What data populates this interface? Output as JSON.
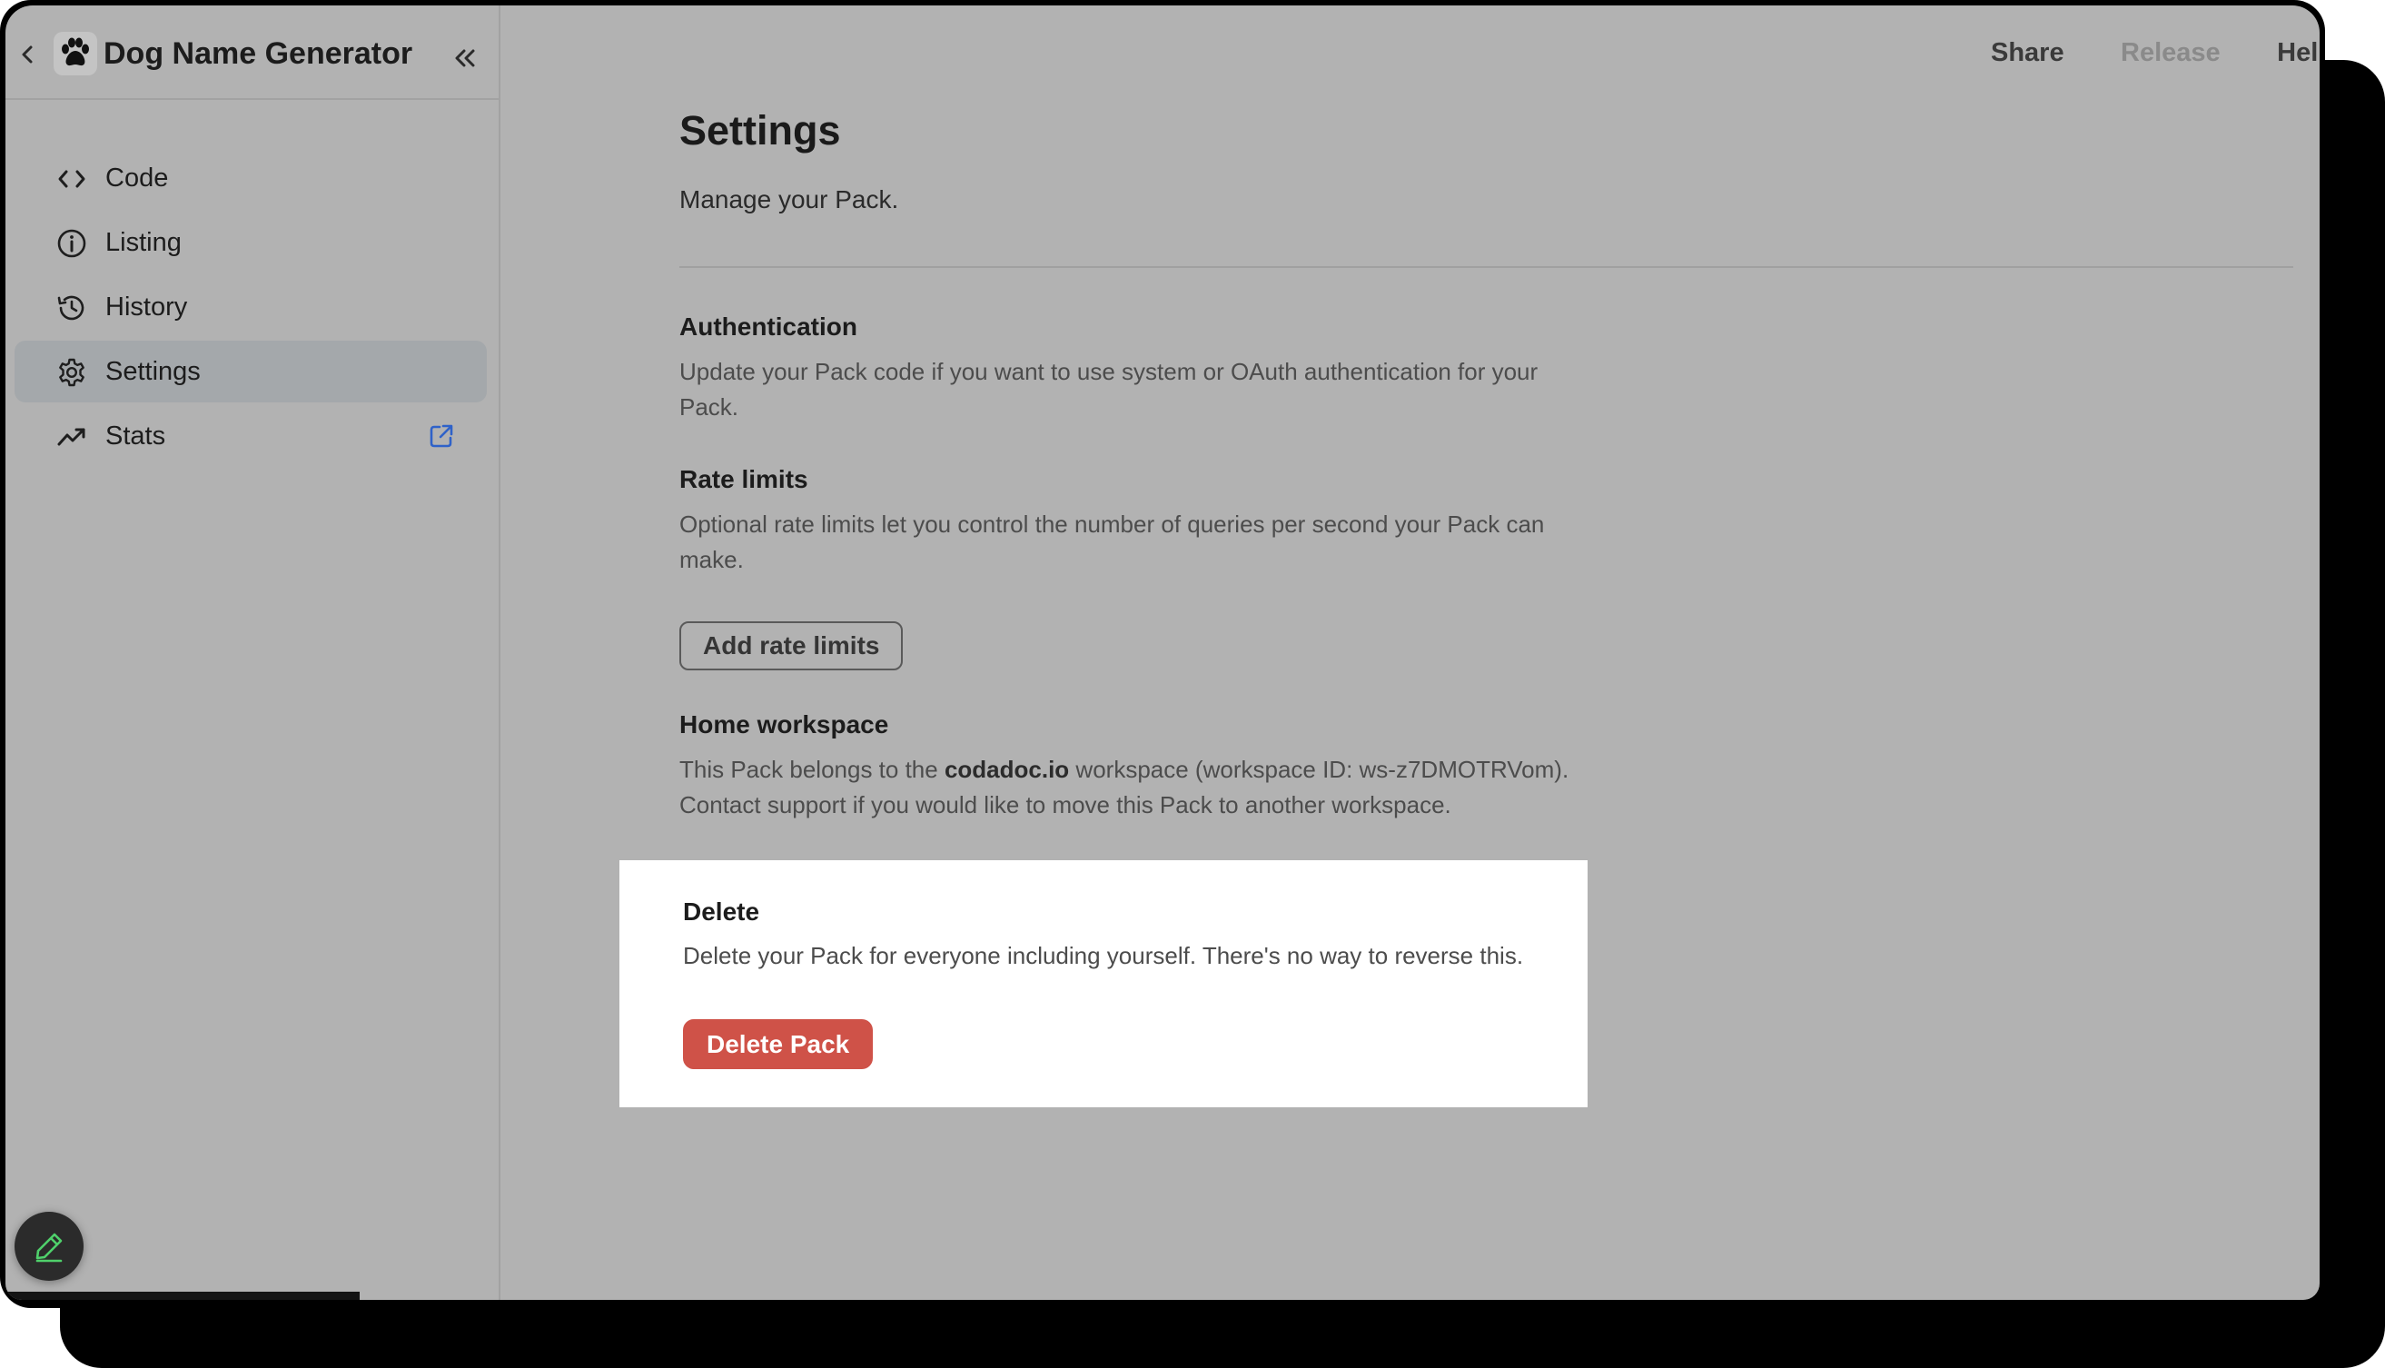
{
  "window": {
    "app_title": "Dog Name Generator"
  },
  "sidebar": {
    "items": [
      {
        "label": "Code",
        "icon": "code-icon",
        "active": false
      },
      {
        "label": "Listing",
        "icon": "info-icon",
        "active": false
      },
      {
        "label": "History",
        "icon": "history-icon",
        "active": false
      },
      {
        "label": "Settings",
        "icon": "gear-icon",
        "active": true
      },
      {
        "label": "Stats",
        "icon": "trending-up-icon",
        "active": false,
        "trailing_icon": "external-link-icon"
      }
    ]
  },
  "topbar": {
    "share_label": "Share",
    "release_label": "Release",
    "help_label": "Help"
  },
  "main": {
    "title": "Settings",
    "subtitle": "Manage your Pack.",
    "authentication": {
      "heading": "Authentication",
      "text": "Update your Pack code if you want to use system or OAuth authentication for your Pack."
    },
    "rate_limits": {
      "heading": "Rate limits",
      "text": "Optional rate limits let you control the number of queries per second your Pack can make.",
      "button_label": "Add rate limits"
    },
    "home_workspace": {
      "heading": "Home workspace",
      "text_before": "This Pack belongs to the ",
      "workspace_name": "codadoc.io",
      "text_after": " workspace (workspace ID: ws-z7DMOTRVom). Contact support if you would like to move this Pack to another workspace."
    },
    "delete": {
      "heading": "Delete",
      "text": "Delete your Pack for everyone including yourself. There's no way to reverse this.",
      "button_label": "Delete Pack"
    }
  },
  "colors": {
    "overlay_gray": "#b2b2b2",
    "active_nav": "#a4a8ab",
    "danger": "#cf5248",
    "link_blue": "#2f62c9",
    "fab_icon_green": "#4fd06b"
  }
}
